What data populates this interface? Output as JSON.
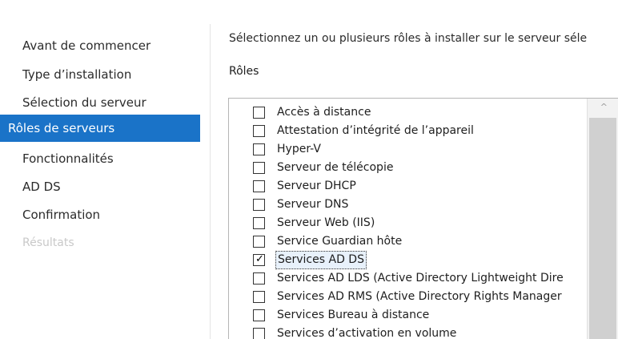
{
  "sidebar": {
    "items": [
      {
        "label": "Avant de commencer",
        "state": "normal"
      },
      {
        "label": "Type d’installation",
        "state": "normal"
      },
      {
        "label": "Sélection du serveur",
        "state": "normal"
      },
      {
        "label": "Rôles de serveurs",
        "state": "selected"
      },
      {
        "label": "Fonctionnalités",
        "state": "normal"
      },
      {
        "label": "AD DS",
        "state": "normal"
      },
      {
        "label": "Confirmation",
        "state": "normal"
      },
      {
        "label": "Résultats",
        "state": "disabled"
      }
    ]
  },
  "main": {
    "instruction": "Sélectionnez un ou plusieurs rôles à installer sur le serveur séle",
    "roles_heading": "Rôles",
    "roles": [
      {
        "label": "Accès à distance",
        "checked": false
      },
      {
        "label": "Attestation d’intégrité de l’appareil",
        "checked": false
      },
      {
        "label": "Hyper-V",
        "checked": false
      },
      {
        "label": "Serveur de télécopie",
        "checked": false
      },
      {
        "label": "Serveur DHCP",
        "checked": false
      },
      {
        "label": "Serveur DNS",
        "checked": false
      },
      {
        "label": "Serveur Web (IIS)",
        "checked": false
      },
      {
        "label": "Service Guardian hôte",
        "checked": false
      },
      {
        "label": "Services AD DS",
        "checked": true
      },
      {
        "label": "Services AD LDS (Active Directory Lightweight Dire",
        "checked": false
      },
      {
        "label": "Services AD RMS (Active Directory Rights Manager",
        "checked": false
      },
      {
        "label": "Services Bureau à distance",
        "checked": false
      },
      {
        "label": "Services d’activation en volume",
        "checked": false
      }
    ],
    "check_glyph": "✓",
    "scroll_up_glyph": "^"
  },
  "colors": {
    "selection_blue": "#1a73c8",
    "disabled_text": "#c9c9c9"
  }
}
